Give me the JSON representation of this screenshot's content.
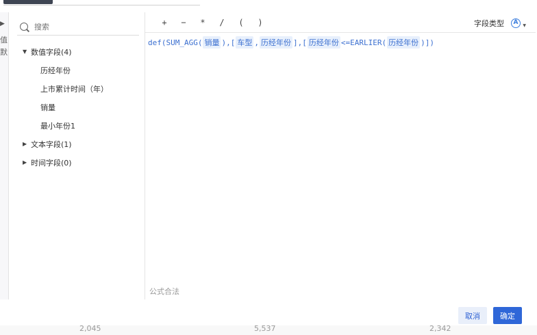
{
  "search": {
    "placeholder": "搜索"
  },
  "fields": {
    "groups": [
      {
        "label": "数值字段(4)",
        "expanded": true,
        "items": [
          "历经年份",
          "上市累计时间（年）",
          "销量",
          "最小年份1"
        ]
      },
      {
        "label": "文本字段(1)",
        "expanded": false,
        "items": []
      },
      {
        "label": "时间字段(0)",
        "expanded": false,
        "items": []
      }
    ]
  },
  "toolbar": {
    "operators": [
      "+",
      "−",
      "*",
      "/",
      "(",
      ")"
    ],
    "field_type_label": "字段类型",
    "field_type_icon": "Ⓐ"
  },
  "formula": {
    "tokens": [
      {
        "t": "text",
        "v": "def(SUM_AGG("
      },
      {
        "t": "chip",
        "v": "销量"
      },
      {
        "t": "text",
        "v": "),["
      },
      {
        "t": "chip",
        "v": "车型"
      },
      {
        "t": "text",
        "v": ","
      },
      {
        "t": "chip",
        "v": "历经年份"
      },
      {
        "t": "text",
        "v": "],["
      },
      {
        "t": "chip",
        "v": "历经年份"
      },
      {
        "t": "text",
        "v": "<=EARLIER("
      },
      {
        "t": "chip",
        "v": "历经年份"
      },
      {
        "t": "text",
        "v": ")])"
      }
    ]
  },
  "status": {
    "valid_text": "公式合法"
  },
  "buttons": {
    "cancel": "取消",
    "ok": "确定"
  },
  "background": {
    "left_chars": [
      "值",
      "默"
    ],
    "bottom_values": [
      "2,045",
      "5,537",
      "2,342"
    ]
  },
  "colors": {
    "accent": "#2f67d8",
    "chip_bg": "#e8f0fc",
    "formula": "#3b6fd0"
  }
}
